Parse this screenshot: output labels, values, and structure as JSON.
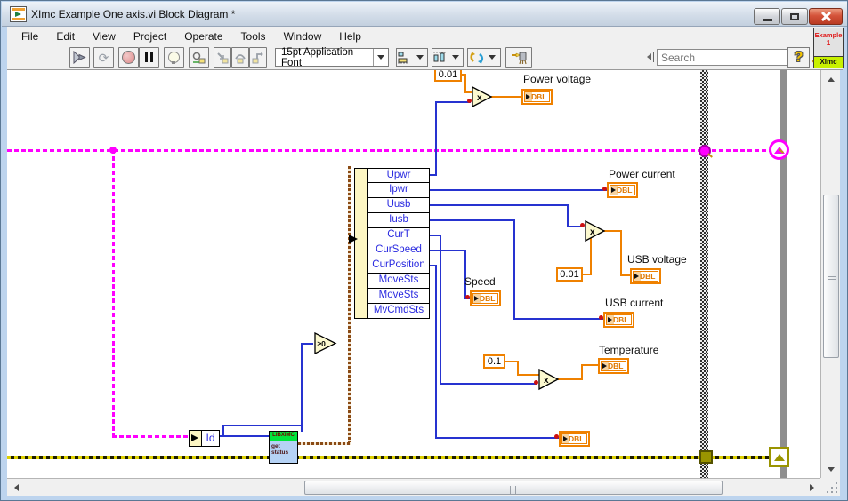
{
  "window": {
    "title": "XImc Example One axis.vi Block Diagram *",
    "vi_badge": {
      "line1": "Example",
      "line2": "1",
      "line3": "XImc"
    }
  },
  "menu": {
    "items": [
      "File",
      "Edit",
      "View",
      "Project",
      "Operate",
      "Tools",
      "Window",
      "Help"
    ]
  },
  "toolbar": {
    "font_label": "15pt Application Font",
    "search_placeholder": "Search",
    "help_glyph": "?"
  },
  "diagram": {
    "constants": {
      "power_scale": "0.01",
      "usb_scale": "0.01",
      "temp_scale": "0.1"
    },
    "operators": {
      "multiply": "x",
      "geq_zero": "≥0"
    },
    "unbundle_fields": [
      "Upwr",
      "Ipwr",
      "Uusb",
      "Iusb",
      "CurT",
      "CurSpeed",
      "CurPosition",
      "MoveSts",
      "MoveSts",
      "MvCmdSts"
    ],
    "id_node": {
      "field": "Id"
    },
    "subvi": {
      "header": "LIBXIMC",
      "body_line1": "get",
      "body_line2": "status"
    },
    "indicators": {
      "power_voltage": {
        "label": "Power voltage",
        "type": "DBL"
      },
      "power_current": {
        "label": "Power current",
        "type": "DBL"
      },
      "usb_voltage": {
        "label": "USB voltage",
        "type": "DBL"
      },
      "usb_current": {
        "label": "USB current",
        "type": "DBL"
      },
      "speed": {
        "label": "Speed",
        "type": "DBL"
      },
      "temperature": {
        "label": "Temperature",
        "type": "DBL"
      },
      "position": {
        "type": "DBL"
      }
    },
    "colors": {
      "numeric_wire_blue": "#2633d0",
      "float_orange": "#ef8100",
      "cluster_magenta": "#ff00ff",
      "error_olive": "#9a9400",
      "cluster_brown": "#8a4a14"
    }
  }
}
